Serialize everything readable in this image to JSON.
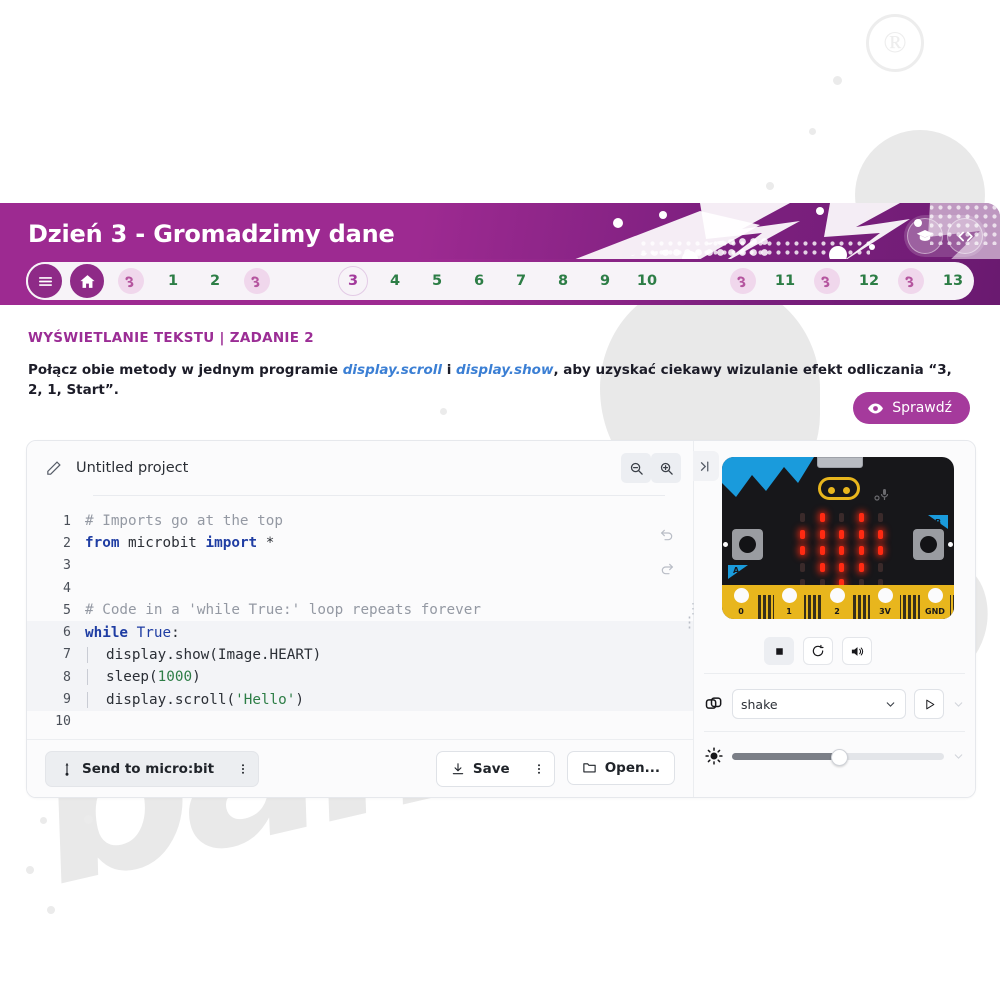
{
  "header": {
    "title": "Dzień 3 - Gromadzimy dane",
    "buttons": [
      {
        "name": "graduation-cap-button",
        "icon": "graduation-cap-icon"
      },
      {
        "name": "code-view-button",
        "icon": "code-brackets-icon"
      }
    ],
    "bg_color": "#9d2a91"
  },
  "nav": {
    "menu_icon": "hamburger-menu-icon",
    "home_icon": "home-icon",
    "items": [
      {
        "type": "bee",
        "label": ""
      },
      {
        "type": "num",
        "label": "1"
      },
      {
        "type": "num",
        "label": "2"
      },
      {
        "type": "bee",
        "label": ""
      },
      {
        "type": "gap",
        "label": ""
      },
      {
        "type": "num",
        "label": "3",
        "active": true
      },
      {
        "type": "num",
        "label": "4"
      },
      {
        "type": "num",
        "label": "5"
      },
      {
        "type": "num",
        "label": "6"
      },
      {
        "type": "num",
        "label": "7"
      },
      {
        "type": "num",
        "label": "8"
      },
      {
        "type": "num",
        "label": "9"
      },
      {
        "type": "num",
        "label": "10"
      },
      {
        "type": "gap",
        "label": ""
      },
      {
        "type": "bee",
        "label": ""
      },
      {
        "type": "num",
        "label": "11"
      },
      {
        "type": "bee",
        "label": ""
      },
      {
        "type": "num",
        "label": "12"
      },
      {
        "type": "bee",
        "label": ""
      },
      {
        "type": "num",
        "label": "13"
      }
    ]
  },
  "task": {
    "title": "WYŚWIETLANIE TEKSTU | ZADANIE 2",
    "desc_part1": "Połącz obie metody w jednym programie ",
    "desc_link1": "display.scroll",
    "desc_mid": " i ",
    "desc_link2": "display.show",
    "desc_part2": ", aby uzyskać ciekawy wizulanie efekt odliczania “3, 2, 1, Start”.",
    "check_label": "Sprawdź",
    "check_icon": "eye-icon",
    "accent_color": "#a53a9c"
  },
  "editor": {
    "project_name": "Untitled project",
    "edit_icon": "pencil-icon",
    "zoom_out_icon": "zoom-out-icon",
    "zoom_in_icon": "zoom-in-icon",
    "undo_icon": "undo-icon",
    "redo_icon": "redo-icon",
    "lines": [
      {
        "n": "1",
        "tokens": [
          {
            "t": "# Imports go at the top",
            "c": "cmt"
          }
        ]
      },
      {
        "n": "2",
        "tokens": [
          {
            "t": "from",
            "c": "kw"
          },
          {
            "t": " microbit ",
            "c": ""
          },
          {
            "t": "import",
            "c": "kw"
          },
          {
            "t": " *",
            "c": ""
          }
        ]
      },
      {
        "n": "3",
        "tokens": []
      },
      {
        "n": "4",
        "tokens": []
      },
      {
        "n": "5",
        "tokens": [
          {
            "t": "# Code in a 'while True:' loop repeats forever",
            "c": "cmt"
          }
        ]
      },
      {
        "n": "6",
        "tokens": [
          {
            "t": "while",
            "c": "kw"
          },
          {
            "t": " ",
            "c": ""
          },
          {
            "t": "True",
            "c": "kw2"
          },
          {
            "t": ":",
            "c": ""
          }
        ],
        "hl": true
      },
      {
        "n": "7",
        "tokens": [
          {
            "t": "display.show(Image.HEART)",
            "c": ""
          }
        ],
        "indent": true,
        "hl": true
      },
      {
        "n": "8",
        "tokens": [
          {
            "t": "sleep(",
            "c": ""
          },
          {
            "t": "1000",
            "c": "num"
          },
          {
            "t": ")",
            "c": ""
          }
        ],
        "indent": true,
        "hl": true
      },
      {
        "n": "9",
        "tokens": [
          {
            "t": "display.scroll(",
            "c": ""
          },
          {
            "t": "'Hello'",
            "c": "str"
          },
          {
            "t": ")",
            "c": ""
          }
        ],
        "indent": true,
        "hl": true
      },
      {
        "n": "10",
        "tokens": []
      }
    ],
    "footer": {
      "send_label": "Send to micro:bit",
      "send_icon": "usb-icon",
      "send_kebab_icon": "kebab-menu-icon",
      "save_label": "Save",
      "save_icon": "download-icon",
      "save_kebab_icon": "kebab-menu-icon",
      "open_label": "Open...",
      "open_icon": "folder-icon"
    }
  },
  "simulator": {
    "collapse_icon": "collapse-panel-icon",
    "board": {
      "led_matrix": [
        [
          0,
          1,
          0,
          1,
          0
        ],
        [
          1,
          1,
          1,
          1,
          1
        ],
        [
          1,
          1,
          1,
          1,
          1
        ],
        [
          0,
          1,
          1,
          1,
          0
        ],
        [
          0,
          0,
          1,
          0,
          0
        ]
      ],
      "pins": [
        "0",
        "1",
        "2",
        "3V",
        "GND"
      ],
      "button_a_label": "A",
      "button_b_label": "B",
      "led_on_color": "#ff2a12",
      "board_color": "#17171a",
      "pin_color": "#e8b61d"
    },
    "controls": [
      {
        "name": "stop-button",
        "icon": "stop-icon"
      },
      {
        "name": "restart-button",
        "icon": "restart-icon"
      },
      {
        "name": "sound-button",
        "icon": "speaker-icon"
      }
    ],
    "gesture": {
      "icon": "gesture-icon",
      "value": "shake",
      "caret_icon": "chevron-down-icon",
      "play_icon": "play-icon",
      "expand_icon": "chevron-down-icon"
    },
    "brightness": {
      "icon": "sun-icon",
      "value": 50,
      "expand_icon": "chevron-down-icon"
    }
  },
  "watermark": {
    "text": "bambino",
    "registered_mark": "®"
  }
}
